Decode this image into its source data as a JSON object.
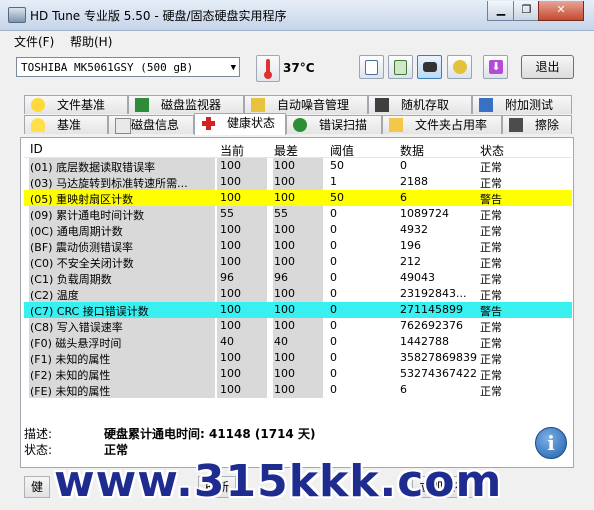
{
  "window": {
    "title": "HD Tune 专业版 5.50 - 硬盘/固态硬盘实用程序",
    "buttons": [
      "▁",
      "❐",
      "✕"
    ]
  },
  "menu": [
    "文件(F)",
    "帮助(H)"
  ],
  "toolbar": {
    "drive": "TOSHIBA MK5061GSY (500 gB)",
    "temperature": "37°C",
    "exit_label": "退出",
    "tool_icons": [
      "copy-icon",
      "copy-text-icon",
      "camera-icon",
      "settings-icon",
      "download-icon"
    ]
  },
  "tabs_top": [
    {
      "label": "文件基准",
      "icon": "file-benchmark-icon"
    },
    {
      "label": "磁盘监视器",
      "icon": "disk-monitor-icon"
    },
    {
      "label": "自动噪音管理",
      "icon": "speaker-icon"
    },
    {
      "label": "随机存取",
      "icon": "random-access-icon"
    },
    {
      "label": "附加测试",
      "icon": "extra-tests-icon"
    }
  ],
  "tabs_bottom": [
    {
      "label": "基准",
      "icon": "benchmark-icon"
    },
    {
      "label": "磁盘信息",
      "icon": "disk-info-icon"
    },
    {
      "label": "健康状态",
      "icon": "health-cross-icon"
    },
    {
      "label": "错误扫描",
      "icon": "error-scan-icon"
    },
    {
      "label": "文件夹占用率",
      "icon": "folder-usage-icon"
    },
    {
      "label": "擦除",
      "icon": "erase-trash-icon"
    }
  ],
  "table": {
    "headers": [
      "ID",
      "当前",
      "最差",
      "阈值",
      "数据",
      "状态"
    ],
    "rows": [
      {
        "id": "(01) 底层数据读取错误率",
        "cur": "100",
        "worst": "100",
        "thr": "50",
        "data": "0",
        "status": "正常",
        "hl": ""
      },
      {
        "id": "(03) 马达旋转到标准转速所需...",
        "cur": "100",
        "worst": "100",
        "thr": "1",
        "data": "2188",
        "status": "正常",
        "hl": ""
      },
      {
        "id": "(05) 重映射扇区计数",
        "cur": "100",
        "worst": "100",
        "thr": "50",
        "data": "6",
        "status": "警告",
        "hl": "yellow"
      },
      {
        "id": "(09) 累计通电时间计数",
        "cur": "55",
        "worst": "55",
        "thr": "0",
        "data": "1089724",
        "status": "正常",
        "hl": ""
      },
      {
        "id": "(0C) 通电周期计数",
        "cur": "100",
        "worst": "100",
        "thr": "0",
        "data": "4932",
        "status": "正常",
        "hl": ""
      },
      {
        "id": "(BF) 震动侦测错误率",
        "cur": "100",
        "worst": "100",
        "thr": "0",
        "data": "196",
        "status": "正常",
        "hl": ""
      },
      {
        "id": "(C0) 不安全关闭计数",
        "cur": "100",
        "worst": "100",
        "thr": "0",
        "data": "212",
        "status": "正常",
        "hl": ""
      },
      {
        "id": "(C1) 负载周期数",
        "cur": "96",
        "worst": "96",
        "thr": "0",
        "data": "49043",
        "status": "正常",
        "hl": ""
      },
      {
        "id": "(C2) 温度",
        "cur": "100",
        "worst": "100",
        "thr": "0",
        "data": "23192843...",
        "status": "正常",
        "hl": ""
      },
      {
        "id": "(C7) CRC 接口错误计数",
        "cur": "100",
        "worst": "100",
        "thr": "0",
        "data": "271145899",
        "status": "警告",
        "hl": "cyan"
      },
      {
        "id": "(C8) 写入错误速率",
        "cur": "100",
        "worst": "100",
        "thr": "0",
        "data": "762692376",
        "status": "正常",
        "hl": ""
      },
      {
        "id": "(F0) 磁头悬浮时间",
        "cur": "40",
        "worst": "40",
        "thr": "0",
        "data": "1442788",
        "status": "正常",
        "hl": ""
      },
      {
        "id": "(F1) 未知的属性",
        "cur": "100",
        "worst": "100",
        "thr": "0",
        "data": "35827869839",
        "status": "正常",
        "hl": ""
      },
      {
        "id": "(F2) 未知的属性",
        "cur": "100",
        "worst": "100",
        "thr": "0",
        "data": "53274367422",
        "status": "正常",
        "hl": ""
      },
      {
        "id": "(FE) 未知的属性",
        "cur": "100",
        "worst": "100",
        "thr": "0",
        "data": "6",
        "status": "正常",
        "hl": ""
      }
    ]
  },
  "details": {
    "desc_label": "描述:",
    "desc_value": "硬盘累计通电时间: 41148 (1714 天)",
    "status_label": "状态:",
    "status_value": "正常"
  },
  "bottom": {
    "left_label": "健",
    "mid_label": "刷新",
    "right_label": "立即保存"
  },
  "watermark": "www.315kkk.com",
  "colors": {
    "warn_yellow": "#ffff00",
    "warn_cyan": "#38f0f0"
  }
}
